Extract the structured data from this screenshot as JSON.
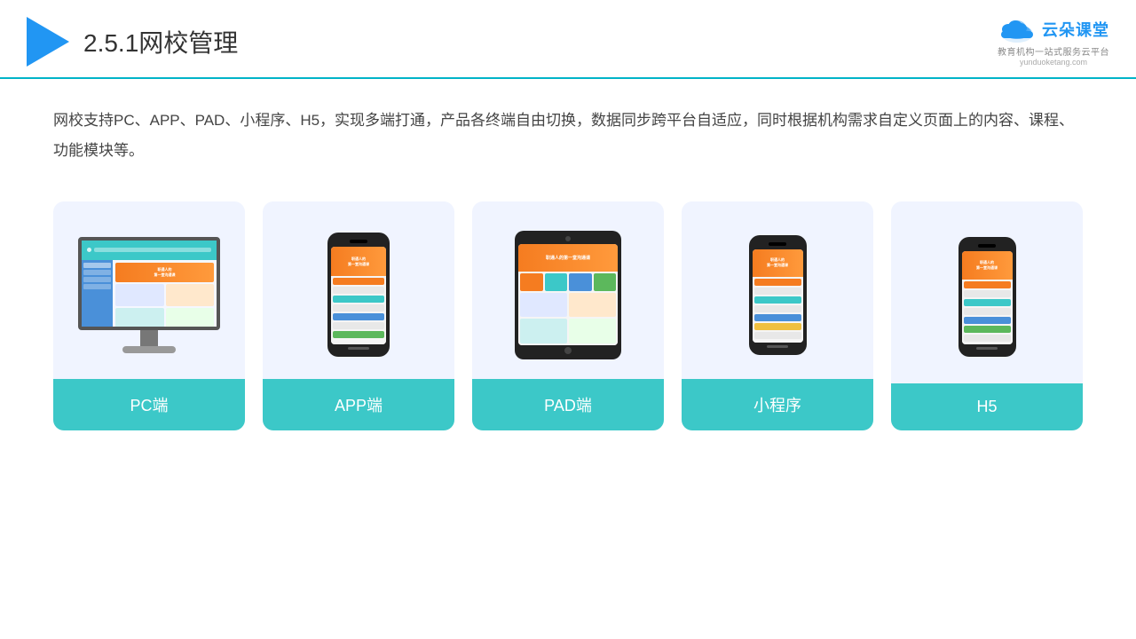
{
  "header": {
    "title": "2.5.1网校管理",
    "logo_brand": "云朵课堂",
    "logo_url": "yunduoketang.com",
    "logo_tagline": "教育机构一站式服务云平台"
  },
  "description": {
    "text": "网校支持PC、APP、PAD、小程序、H5，实现多端打通，产品各终端自由切换，数据同步跨平台自适应，同时根据机构需求自定义页面上的内容、课程、功能模块等。"
  },
  "cards": [
    {
      "id": "pc",
      "label": "PC端"
    },
    {
      "id": "app",
      "label": "APP端"
    },
    {
      "id": "pad",
      "label": "PAD端"
    },
    {
      "id": "miniapp",
      "label": "小程序"
    },
    {
      "id": "h5",
      "label": "H5"
    }
  ]
}
